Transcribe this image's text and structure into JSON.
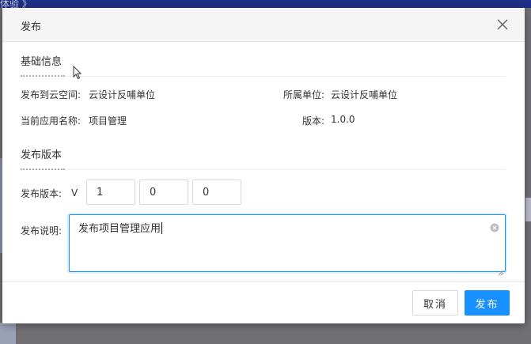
{
  "background": {
    "topbar_text": "体验 》"
  },
  "dialog": {
    "title": "发布",
    "close_icon": "close-icon",
    "section_basic": {
      "title": "基础信息",
      "space_label": "发布到云空间:",
      "space_value": "云设计反哺单位",
      "unit_label": "所属单位:",
      "unit_value": "云设计反哺单位",
      "app_name_label": "当前应用名称:",
      "app_name_value": "项目管理",
      "version_label": "版本:",
      "version_value": "1.0.0"
    },
    "section_release": {
      "title": "发布版本",
      "version_label": "发布版本:",
      "version_prefix": "V",
      "version_major": "1",
      "version_minor": "0",
      "version_patch": "0",
      "desc_label": "发布说明:",
      "desc_value": "发布项目管理应用"
    },
    "buttons": {
      "cancel": "取消",
      "publish": "发布"
    }
  },
  "colors": {
    "primary": "#1890ff",
    "header_bg": "#f5f5f5",
    "topbar": "#1e2f86"
  }
}
